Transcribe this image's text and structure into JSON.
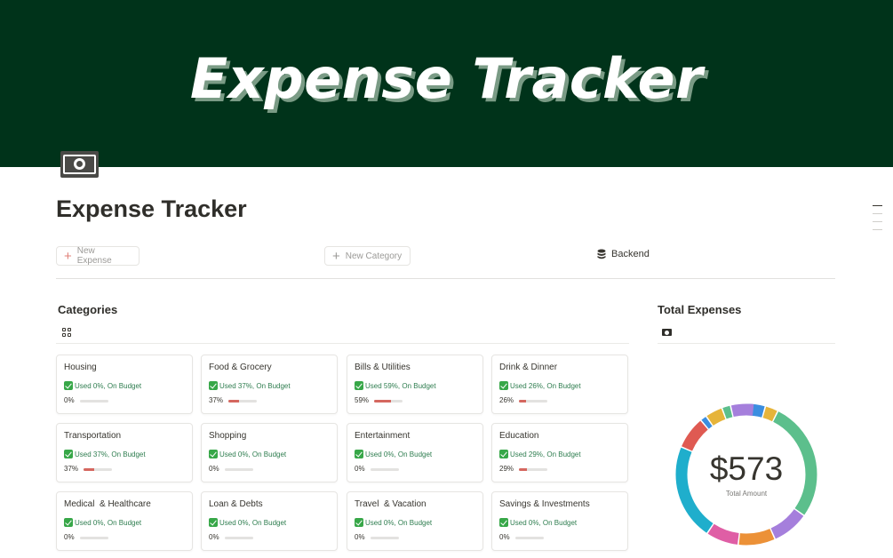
{
  "banner": {
    "title": "Expense Tracker"
  },
  "page": {
    "icon": "money-bill-icon",
    "title": "Expense Tracker"
  },
  "toolbar": {
    "new_expense_label": "New Expense",
    "new_category_label": "New Category",
    "backend_label": "Backend"
  },
  "sections": {
    "categories_title": "Categories",
    "total_title": "Total Expenses"
  },
  "categories": [
    {
      "name": "Housing",
      "status": "Used 0%, On Budget",
      "percent_label": "0%",
      "used": 0
    },
    {
      "name": "Food & Grocery",
      "status": "Used 37%, On Budget",
      "percent_label": "37%",
      "used": 37
    },
    {
      "name": "Bills & Utilities",
      "status": "Used 59%, On Budget",
      "percent_label": "59%",
      "used": 59
    },
    {
      "name": "Drink & Dinner",
      "status": "Used 26%, On Budget",
      "percent_label": "26%",
      "used": 26
    },
    {
      "name": "Transportation",
      "status": "Used 37%, On Budget",
      "percent_label": "37%",
      "used": 37
    },
    {
      "name": "Shopping",
      "status": "Used 0%, On Budget",
      "percent_label": "0%",
      "used": 0
    },
    {
      "name": "Entertainment",
      "status": "Used 0%, On Budget",
      "percent_label": "0%",
      "used": 0
    },
    {
      "name": "Education",
      "status": "Used 29%, On Budget",
      "percent_label": "29%",
      "used": 29
    },
    {
      "name": "Medical  & Healthcare",
      "status": "Used 0%, On Budget",
      "percent_label": "0%",
      "used": 0
    },
    {
      "name": "Loan & Debts",
      "status": "Used 0%, On Budget",
      "percent_label": "0%",
      "used": 0
    },
    {
      "name": "Travel  & Vacation",
      "status": "Used 0%, On Budget",
      "percent_label": "0%",
      "used": 0
    },
    {
      "name": "Savings & Investments",
      "status": "Used 0%, On Budget",
      "percent_label": "0%",
      "used": 0
    }
  ],
  "total": {
    "amount": "$573",
    "caption": "Total Amount",
    "segments": [
      {
        "share": 0.045,
        "color": "#3b8ee0"
      },
      {
        "share": 0.03,
        "color": "#e6b43a"
      },
      {
        "share": 0.275,
        "color": "#5cbf8c"
      },
      {
        "share": 0.085,
        "color": "#a57fdc"
      },
      {
        "share": 0.085,
        "color": "#ec9137"
      },
      {
        "share": 0.075,
        "color": "#df5ea5"
      },
      {
        "share": 0.22,
        "color": "#1faecc"
      },
      {
        "share": 0.075,
        "color": "#df5a52"
      },
      {
        "share": 0.015,
        "color": "#3b8ee0"
      },
      {
        "share": 0.04,
        "color": "#e6b43a"
      },
      {
        "share": 0.02,
        "color": "#5cbf8c"
      },
      {
        "share": 0.055,
        "color": "#a57fdc"
      }
    ]
  }
}
